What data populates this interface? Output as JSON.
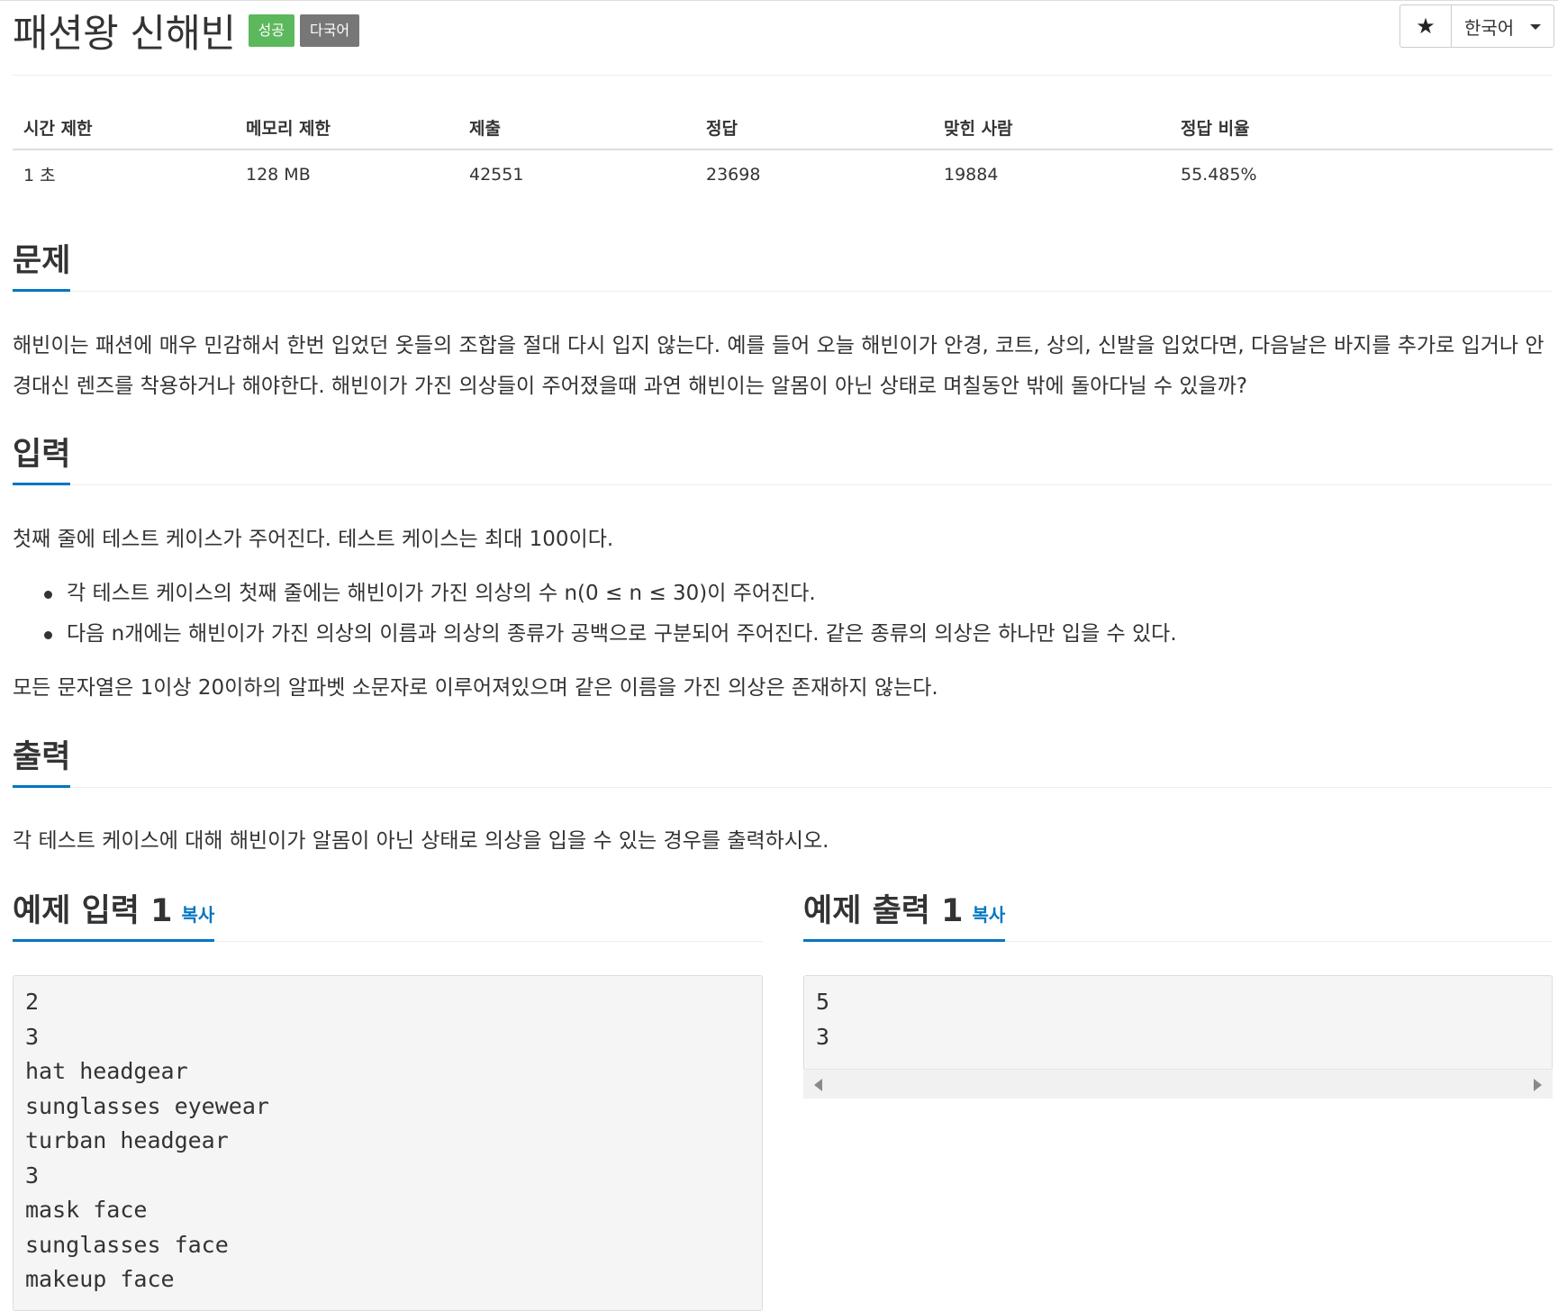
{
  "problem": {
    "title": "패션왕 신해빈",
    "badges": {
      "success": "성공",
      "multilang": "다국어"
    }
  },
  "toolbar": {
    "star_icon": "★",
    "language": "한국어"
  },
  "info": {
    "headers": [
      "시간 제한",
      "메모리 제한",
      "제출",
      "정답",
      "맞힌 사람",
      "정답 비율"
    ],
    "values": [
      "1 초",
      "128 MB",
      "42551",
      "23698",
      "19884",
      "55.485%"
    ]
  },
  "sections": {
    "problem": {
      "title": "문제",
      "text": "해빈이는 패션에 매우 민감해서 한번 입었던 옷들의 조합을 절대 다시 입지 않는다. 예를 들어 오늘 해빈이가 안경, 코트, 상의, 신발을 입었다면, 다음날은 바지를 추가로 입거나 안경대신 렌즈를 착용하거나 해야한다. 해빈이가 가진 의상들이 주어졌을때 과연 해빈이는 알몸이 아닌 상태로 며칠동안 밖에 돌아다닐 수 있을까?"
    },
    "input": {
      "title": "입력",
      "intro": "첫째 줄에 테스트 케이스가 주어진다. 테스트 케이스는 최대 100이다.",
      "bullets": [
        "각 테스트 케이스의 첫째 줄에는 해빈이가 가진 의상의 수 n(0 ≤ n ≤ 30)이 주어진다.",
        "다음 n개에는 해빈이가 가진 의상의 이름과 의상의 종류가 공백으로 구분되어 주어진다. 같은 종류의 의상은 하나만 입을 수 있다."
      ],
      "outro": "모든 문자열은 1이상 20이하의 알파벳 소문자로 이루어져있으며 같은 이름을 가진 의상은 존재하지 않는다."
    },
    "output": {
      "title": "출력",
      "text": "각 테스트 케이스에 대해 해빈이가 알몸이 아닌 상태로 의상을 입을 수 있는 경우를 출력하시오."
    }
  },
  "samples": {
    "input": {
      "title": "예제 입력 1",
      "copy": "복사",
      "content": "2\n3\nhat headgear\nsunglasses eyewear\nturban headgear\n3\nmask face\nsunglasses face\nmakeup face"
    },
    "output": {
      "title": "예제 출력 1",
      "copy": "복사",
      "content": "5\n3"
    }
  }
}
